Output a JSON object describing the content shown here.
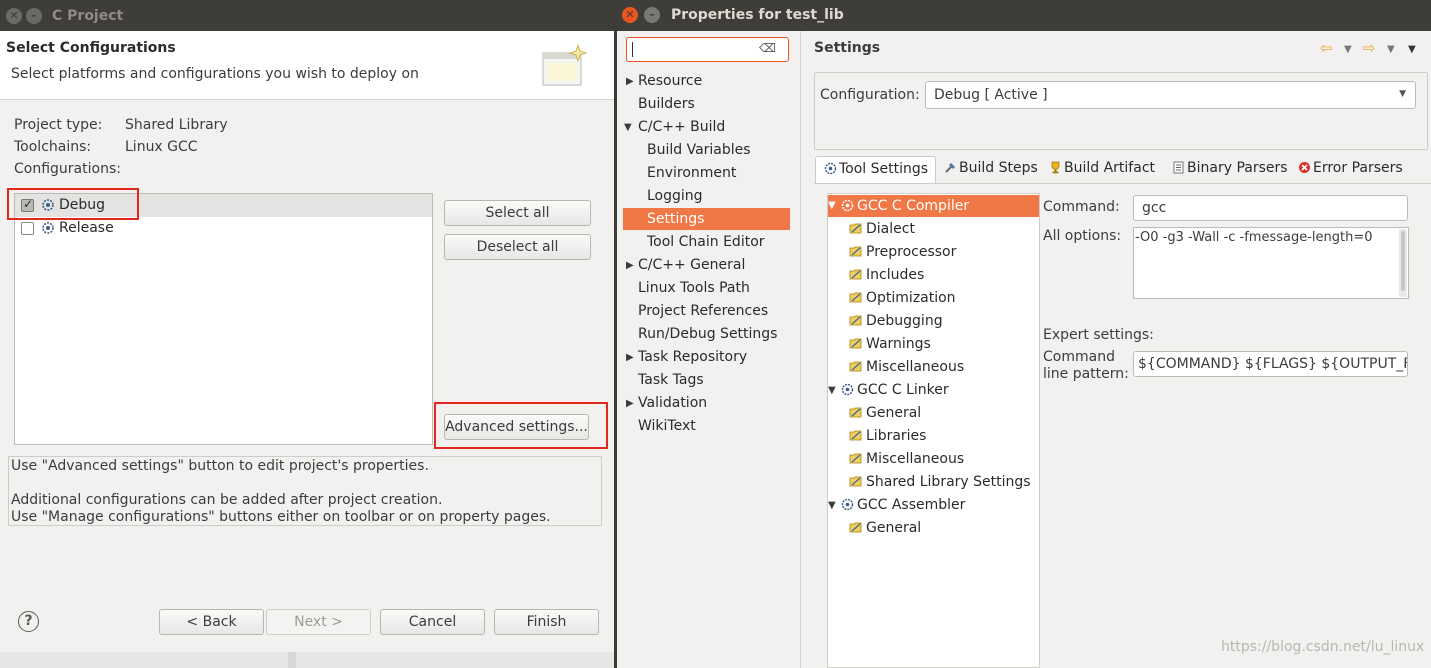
{
  "left_window": {
    "title": "C Project",
    "header_title": "Select Configurations",
    "header_subtitle": "Select platforms and configurations you wish to deploy on",
    "project_type_label": "Project type:",
    "project_type_value": "Shared Library",
    "toolchains_label": "Toolchains:",
    "toolchains_value": "Linux GCC",
    "configurations_label": "Configurations:",
    "configurations": [
      {
        "label": "Debug",
        "checked": true
      },
      {
        "label": "Release",
        "checked": false
      }
    ],
    "select_all": "Select all",
    "deselect_all": "Deselect all",
    "advanced_settings": "Advanced settings...",
    "hint_line1": "Use \"Advanced settings\" button to edit project's properties.",
    "hint_line2": "Additional configurations can be added after project creation.",
    "hint_line3": "Use \"Manage configurations\" buttons either on toolbar or on property pages.",
    "back": "< Back",
    "next": "Next >",
    "cancel": "Cancel",
    "finish": "Finish",
    "help_glyph": "?"
  },
  "right_window": {
    "title": "Properties for test_lib",
    "search_clear_glyph": "⌫",
    "nav_items": [
      {
        "label": "Resource",
        "expandable": true
      },
      {
        "label": "Builders"
      },
      {
        "label": "C/C++ Build",
        "expanded": true
      },
      {
        "label": "Build Variables"
      },
      {
        "label": "Environment"
      },
      {
        "label": "Logging"
      },
      {
        "label": "Settings",
        "selected": true
      },
      {
        "label": "Tool Chain Editor"
      },
      {
        "label": "C/C++ General",
        "expandable": true
      },
      {
        "label": "Linux Tools Path"
      },
      {
        "label": "Project References"
      },
      {
        "label": "Run/Debug Settings"
      },
      {
        "label": "Task Repository",
        "expandable": true
      },
      {
        "label": "Task Tags"
      },
      {
        "label": "Validation",
        "expandable": true
      },
      {
        "label": "WikiText"
      }
    ],
    "page_title": "Settings",
    "configuration_label": "Configuration:",
    "configuration_value": "Debug  [ Active ]",
    "tabs": [
      "Tool Settings",
      "Build Steps",
      "Build Artifact",
      "Binary Parsers",
      "Error Parsers"
    ],
    "tree": [
      {
        "label": "GCC C Compiler",
        "kind": "tool",
        "selected": true
      },
      {
        "label": "Dialect",
        "kind": "option"
      },
      {
        "label": "Preprocessor",
        "kind": "option"
      },
      {
        "label": "Includes",
        "kind": "option"
      },
      {
        "label": "Optimization",
        "kind": "option"
      },
      {
        "label": "Debugging",
        "kind": "option"
      },
      {
        "label": "Warnings",
        "kind": "option"
      },
      {
        "label": "Miscellaneous",
        "kind": "option"
      },
      {
        "label": "GCC C Linker",
        "kind": "tool"
      },
      {
        "label": "General",
        "kind": "option"
      },
      {
        "label": "Libraries",
        "kind": "option"
      },
      {
        "label": "Miscellaneous",
        "kind": "option"
      },
      {
        "label": "Shared Library Settings",
        "kind": "option"
      },
      {
        "label": "GCC Assembler",
        "kind": "tool"
      },
      {
        "label": "General",
        "kind": "option"
      }
    ],
    "command_label": "Command:",
    "command_value": "gcc",
    "all_options_label": "All options:",
    "all_options_value": "-O0 -g3 -Wall -c -fmessage-length=0",
    "expert_label": "Expert settings:",
    "pattern_label_1": "Command",
    "pattern_label_2": "line pattern:",
    "pattern_value": "${COMMAND} ${FLAGS} ${OUTPUT_FLAG}",
    "watermark": "https://blog.csdn.net/lu_linux"
  },
  "colors": {
    "accent": "#f07746",
    "highlight": "#e3261e",
    "titlebar": "#3e3d39"
  }
}
